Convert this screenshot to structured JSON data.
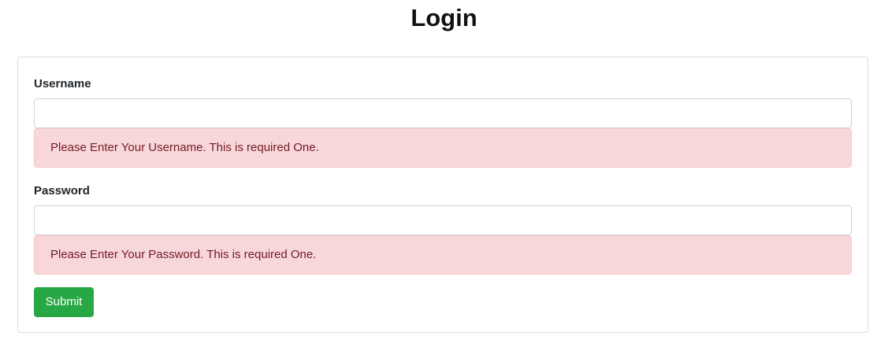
{
  "page": {
    "title": "Login"
  },
  "form": {
    "username": {
      "label": "Username",
      "value": "",
      "placeholder": "",
      "error": "Please Enter Your Username. This is required One."
    },
    "password": {
      "label": "Password",
      "value": "",
      "placeholder": "",
      "error": "Please Enter Your Password. This is required One."
    },
    "submit_label": "Submit"
  },
  "colors": {
    "submit": "#28a745",
    "alert_background": "#f8d7da",
    "alert_text": "#721c24"
  }
}
